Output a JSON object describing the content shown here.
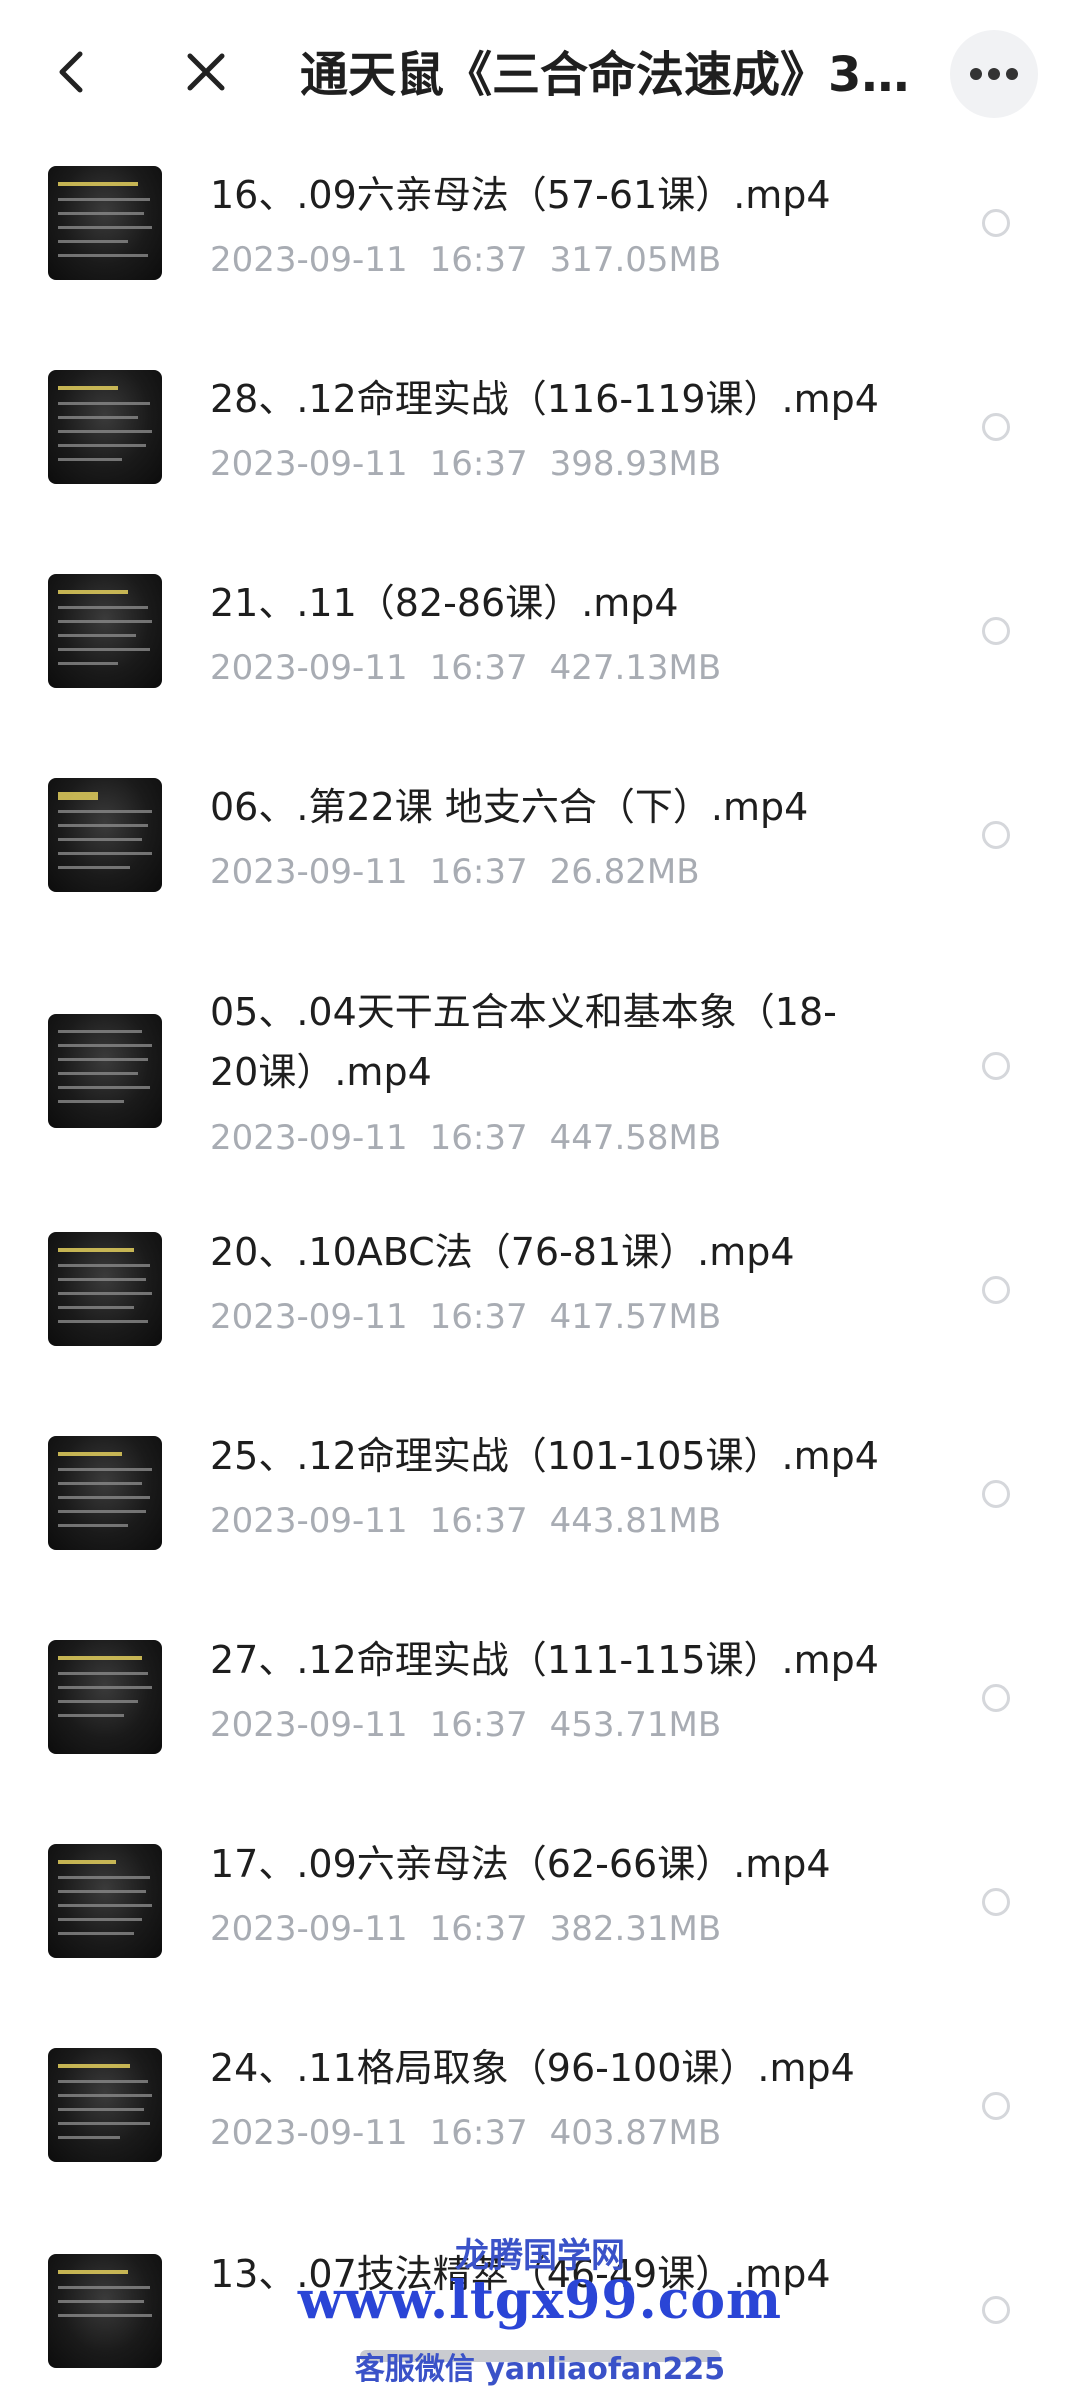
{
  "header": {
    "title": "通天鼠《三合命法速成》3...",
    "back_icon": "chevron-left-icon",
    "close_icon": "close-icon",
    "more_icon": "more-horizontal-icon"
  },
  "files": [
    {
      "name": "16、.09六亲母法（57-61课）.mp4",
      "date": "2023-09-11",
      "time": "16:37",
      "size": "317.05MB"
    },
    {
      "name": "28、.12命理实战（116-119课）.mp4",
      "date": "2023-09-11",
      "time": "16:37",
      "size": "398.93MB"
    },
    {
      "name": "21、.11（82-86课）.mp4",
      "date": "2023-09-11",
      "time": "16:37",
      "size": "427.13MB"
    },
    {
      "name": "06、.第22课  地支六合（下）.mp4",
      "date": "2023-09-11",
      "time": "16:37",
      "size": "26.82MB"
    },
    {
      "name": "05、.04天干五合本义和基本象（18-20课）.mp4",
      "date": "2023-09-11",
      "time": "16:37",
      "size": "447.58MB"
    },
    {
      "name": "20、.10ABC法（76-81课）.mp4",
      "date": "2023-09-11",
      "time": "16:37",
      "size": "417.57MB"
    },
    {
      "name": "25、.12命理实战（101-105课）.mp4",
      "date": "2023-09-11",
      "time": "16:37",
      "size": "443.81MB"
    },
    {
      "name": "27、.12命理实战（111-115课）.mp4",
      "date": "2023-09-11",
      "time": "16:37",
      "size": "453.71MB"
    },
    {
      "name": "17、.09六亲母法（62-66课）.mp4",
      "date": "2023-09-11",
      "time": "16:37",
      "size": "382.31MB"
    },
    {
      "name": "24、.11格局取象（96-100课）.mp4",
      "date": "2023-09-11",
      "time": "16:37",
      "size": "403.87MB"
    },
    {
      "name": "13、.07技法精萃（46-49课）.mp4",
      "date": "",
      "time": "",
      "size": ""
    }
  ],
  "watermark": {
    "line1": "龙腾国学网",
    "line2": "www.ltgx99.com",
    "line3": "客服微信 yanliaofan225"
  }
}
